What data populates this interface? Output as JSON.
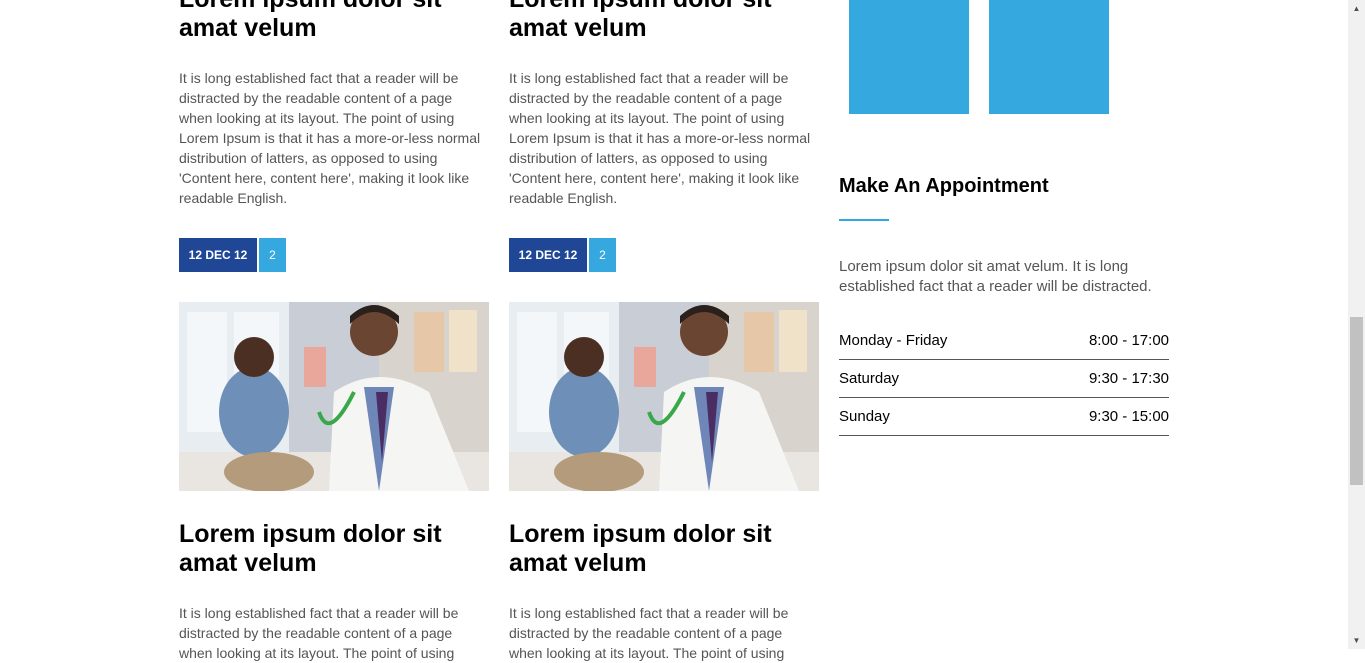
{
  "posts": [
    {
      "title": "Lorem ipsum dolor sit amat velum",
      "body": "It is long established fact that a reader will be distracted by the readable content of a page when looking at its layout. The point of using Lorem Ipsum is that it has a more-or-less normal distribution of latters, as opposed to using 'Content here, content here', making it look like readable English.",
      "date": "12 DEC 12",
      "count": "2"
    },
    {
      "title": "Lorem ipsum dolor sit amat velum",
      "body": "It is long established fact that a reader will be distracted by the readable content of a page when looking at its layout. The point of using Lorem Ipsum is that it has a more-or-less normal distribution of latters, as opposed to using 'Content here, content here', making it look like readable English.",
      "date": "12 DEC 12",
      "count": "2"
    },
    {
      "title": "Lorem ipsum dolor sit amat velum",
      "body": "It is long established fact that a reader will be distracted by the readable content of a page when looking at its layout. The point of using"
    },
    {
      "title": "Lorem ipsum dolor sit amat velum",
      "body": "It is long established fact that a reader will be distracted by the readable content of a page when looking at its layout. The point of using"
    }
  ],
  "appointment": {
    "title": "Make An Appointment",
    "text": "Lorem ipsum dolor sit amat velum. It is long established fact that a reader will be distracted.",
    "hours": [
      {
        "day": "Monday - Friday",
        "time": "8:00 - 17:00"
      },
      {
        "day": "Saturday",
        "time": "9:30 - 17:30"
      },
      {
        "day": "Sunday",
        "time": "9:30 - 15:00"
      }
    ]
  },
  "colors": {
    "date_badge": "#1f4796",
    "count_badge": "#36a8e0",
    "accent": "#36a8e0"
  }
}
